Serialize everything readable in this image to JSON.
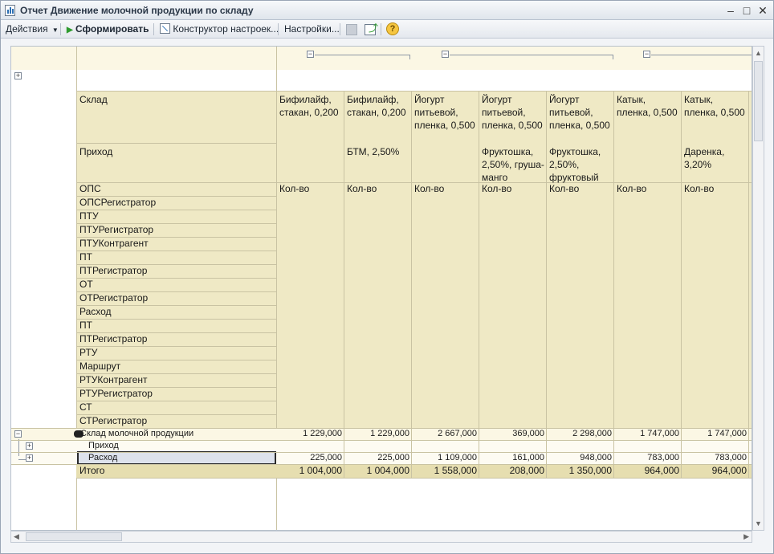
{
  "window": {
    "title": "Отчет  Движение молочной продукции по складу"
  },
  "toolbar": {
    "actions": "Действия",
    "generate": "Сформировать",
    "constructor": "Конструктор настроек...",
    "settings": "Настройки...",
    "help": "?"
  },
  "row_labels": {
    "warehouse": "Склад",
    "income": "Приход",
    "list": [
      "ОПС",
      "ОПСРегистратор",
      "ПТУ",
      "ПТУРегистратор",
      "ПТУКонтрагент",
      "ПТ",
      "ПТРегистратор",
      "ОТ",
      "ОТРегистратор",
      "Расход",
      "ПТ",
      "ПТРегистратор",
      "РТУ",
      "Маршрут",
      "РТУКонтрагент",
      "РТУРегистратор",
      "СТ",
      "СТРегистратор"
    ]
  },
  "columns": [
    {
      "product": "Бифилайф, стакан, 0,200",
      "producer": "",
      "measure": "Кол-во"
    },
    {
      "product": "Бифилайф, стакан, 0,200",
      "producer": "БТМ, 2,50%",
      "measure": "Кол-во"
    },
    {
      "product": "Йогурт питьевой, пленка, 0,500",
      "producer": "",
      "measure": "Кол-во"
    },
    {
      "product": "Йогурт питьевой, пленка, 0,500",
      "producer": "Фруктошка, 2,50%, груша-манго",
      "measure": "Кол-во"
    },
    {
      "product": "Йогурт питьевой, пленка, 0,500",
      "producer": "Фруктошка, 2,50%, фруктовый",
      "measure": "Кол-во"
    },
    {
      "product": "Катык, пленка, 0,500",
      "producer": "",
      "measure": "Кол-во"
    },
    {
      "product": "Катык, пленка, 0,500",
      "producer": "Даренка, 3,20%",
      "measure": "Кол-во"
    }
  ],
  "data_rows": {
    "group": {
      "label": "Склад молочной продукции",
      "values": [
        "1 229,000",
        "1 229,000",
        "2 667,000",
        "369,000",
        "2 298,000",
        "1 747,000",
        "1 747,000"
      ]
    },
    "income": {
      "label": "Приход",
      "values": [
        "",
        "",
        "",
        "",
        "",
        "",
        ""
      ]
    },
    "expense": {
      "label": "Расход",
      "values": [
        "225,000",
        "225,000",
        "1 109,000",
        "161,000",
        "948,000",
        "783,000",
        "783,000"
      ]
    },
    "total": {
      "label": "Итого",
      "values": [
        "1 004,000",
        "1 004,000",
        "1 558,000",
        "208,000",
        "1 350,000",
        "964,000",
        "964,000"
      ]
    }
  },
  "icons": {
    "expand": "+",
    "collapse": "−"
  }
}
